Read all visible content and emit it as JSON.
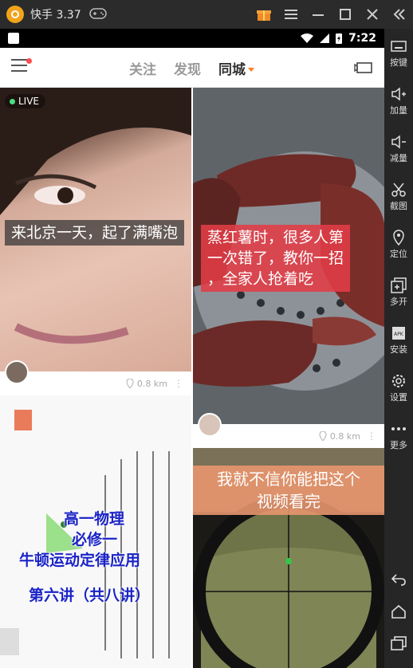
{
  "window": {
    "title": "快手 3.37"
  },
  "statusbar": {
    "time": "7:22"
  },
  "tabs": [
    {
      "label": "关注"
    },
    {
      "label": "发现"
    },
    {
      "label": "同城"
    }
  ],
  "feed": {
    "card1": {
      "badge": "LIVE",
      "caption": "来北京一天，起了满嘴泡",
      "distance": "0.8 km"
    },
    "card2": {
      "caption_lines": [
        "蒸红薯时，很多人第",
        "一次错了，教你一招",
        "，全家人抢着吃"
      ],
      "distance": "0.8 km"
    },
    "card3": {
      "lines": [
        "高一物理",
        "必修一",
        "牛顿运动定律应用",
        "第六讲（共八讲）"
      ]
    },
    "card4": {
      "caption_lines": [
        "我就不信你能把这个",
        "视频看完"
      ]
    }
  },
  "sidebar": [
    {
      "label": "按键",
      "icon": "keyboard-icon"
    },
    {
      "label": "加量",
      "icon": "volume-up-icon"
    },
    {
      "label": "减量",
      "icon": "volume-down-icon"
    },
    {
      "label": "截图",
      "icon": "scissors-icon"
    },
    {
      "label": "定位",
      "icon": "location-icon"
    },
    {
      "label": "多开",
      "icon": "multi-instance-icon"
    },
    {
      "label": "安装",
      "icon": "apk-install-icon"
    },
    {
      "label": "设置",
      "icon": "gear-icon"
    },
    {
      "label": "更多",
      "icon": "more-dots-icon"
    }
  ],
  "colors": {
    "accent": "#ff7b26",
    "caption_red": "#e23c46",
    "emulator_bg": "#2b2b2b"
  }
}
